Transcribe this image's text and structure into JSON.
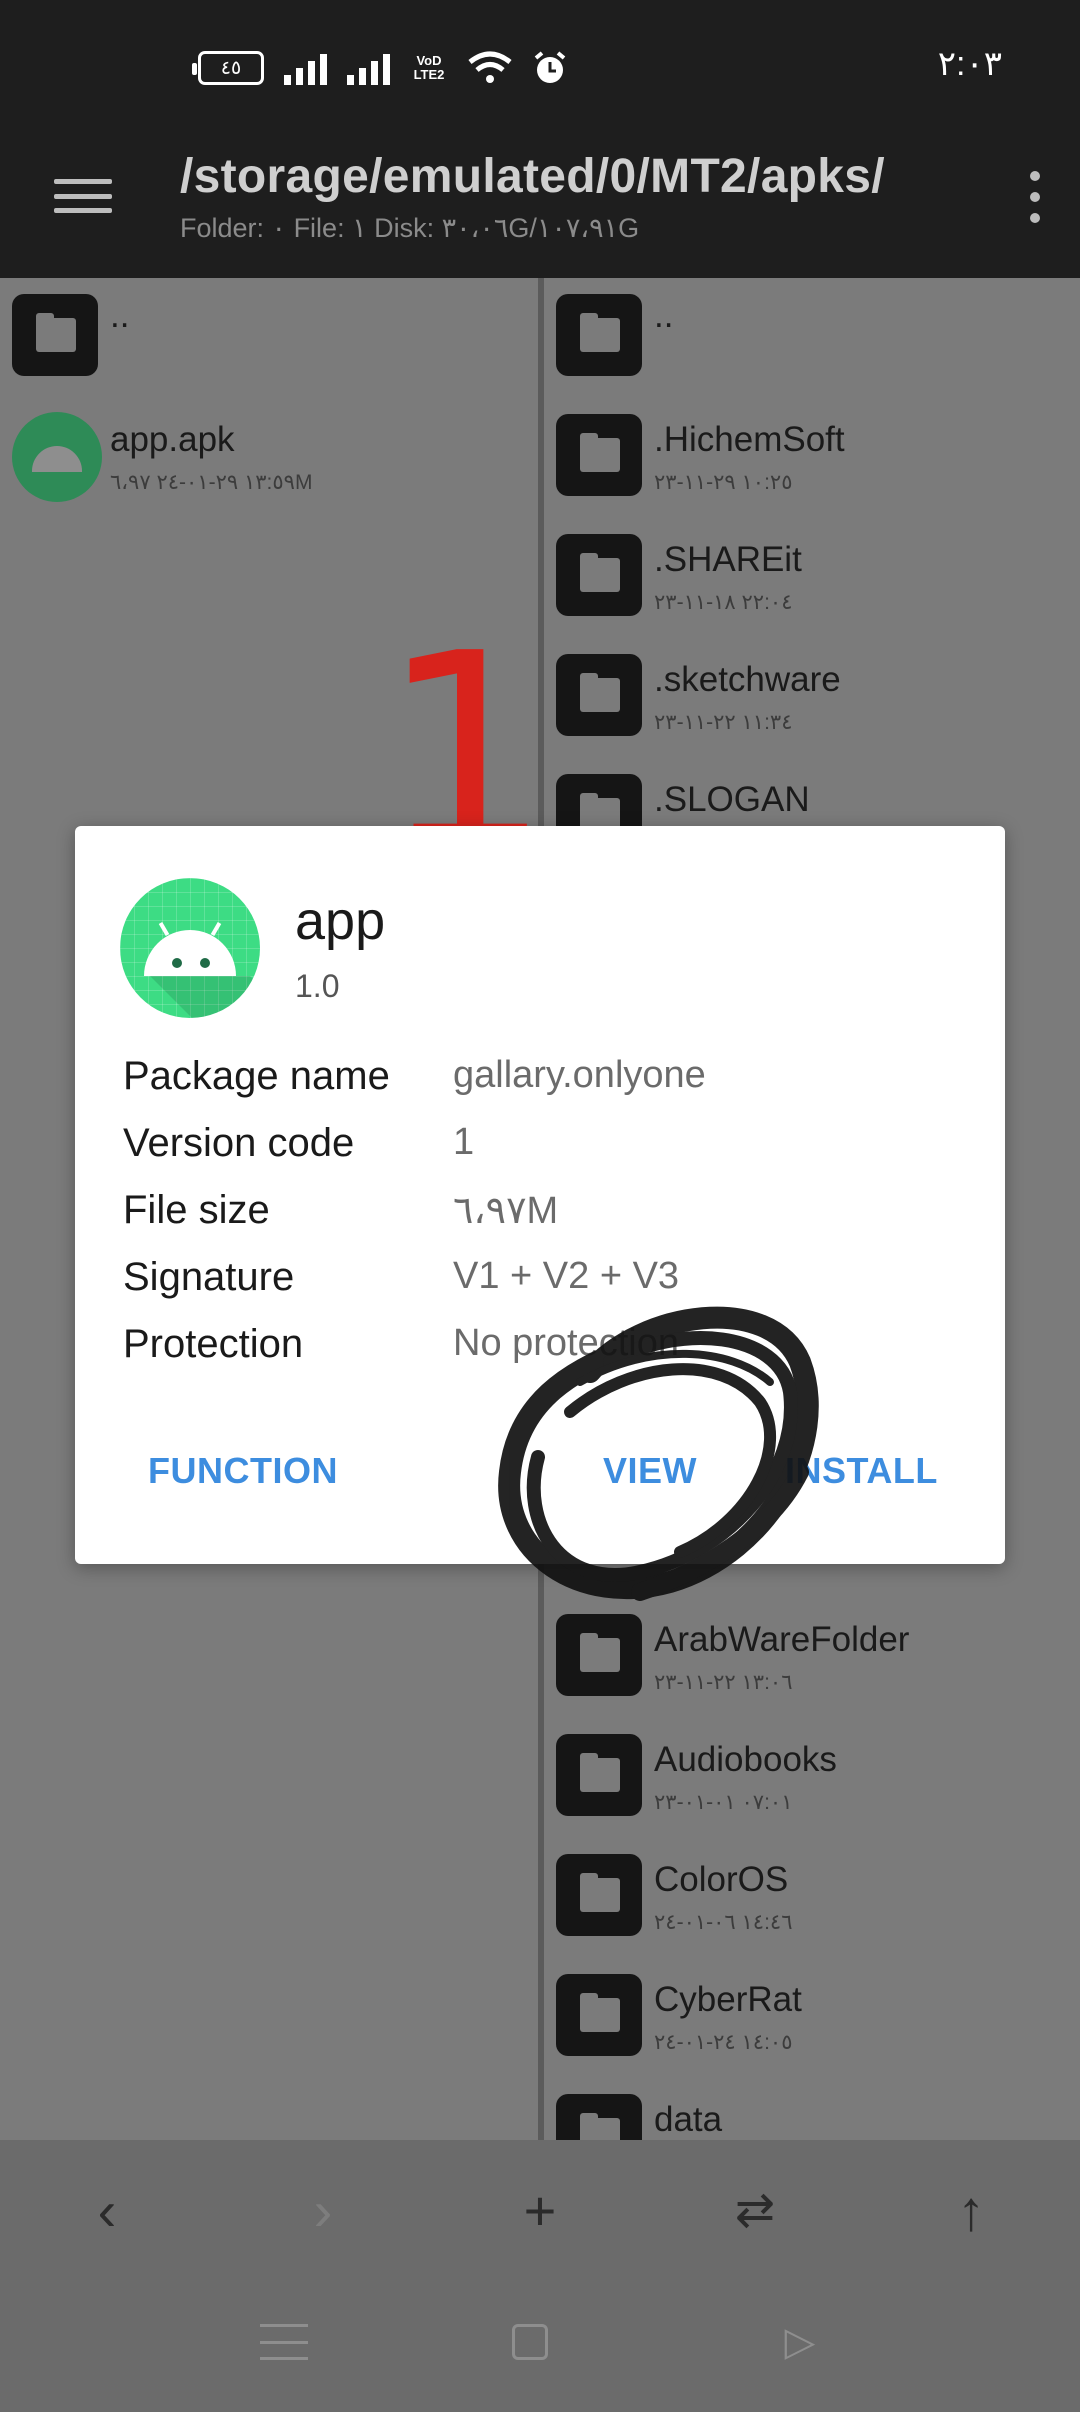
{
  "status_bar": {
    "battery": "٤٥",
    "network_label_1": "VoD",
    "network_label_2": "LTE2",
    "time": "٢:٠٣"
  },
  "toolbar": {
    "path": "/storage/emulated/0/MT2/apks/",
    "info": "Folder: ٠  File: ١  Disk: ٣٠،٠٦G/١٠٧،٩١G"
  },
  "left_pane": {
    "parent": "..",
    "files": [
      {
        "name": "app.apk",
        "meta": "١٣:٥٩ ٢٩-٠١-٢٤  ٦،٩٧M"
      }
    ]
  },
  "annotation": {
    "number": "1"
  },
  "right_pane": {
    "items": [
      {
        "name": "..",
        "meta": ""
      },
      {
        "name": ".HichemSoft",
        "meta": "١٠:٢٥ ٢٩-١١-٢٣"
      },
      {
        "name": ".SHAREit",
        "meta": "٢٢:٠٤ ١٨-١١-٢٣"
      },
      {
        "name": ".sketchware",
        "meta": "١١:٣٤ ٢٢-١١-٢٣"
      },
      {
        "name": ".SLOGAN",
        "meta": ""
      },
      {
        "name": "ArabWareFolder",
        "meta": "١٣:٠٦ ٢٢-١١-٢٣"
      },
      {
        "name": "Audiobooks",
        "meta": "٠٧:٠١ ٠١-٠١-٢٣"
      },
      {
        "name": "ColorOS",
        "meta": "١٤:٤٦ ٠٦-٠١-٢٤"
      },
      {
        "name": "CyberRat",
        "meta": "١٤:٠٥ ٢٤-٠١-٢٤"
      },
      {
        "name": "data",
        "meta": ""
      }
    ]
  },
  "dialog": {
    "app_name": "app",
    "version": "1.0",
    "rows": [
      {
        "label": "Package name",
        "value": "gallary.onlyone"
      },
      {
        "label": "Version code",
        "value": "1"
      },
      {
        "label": "File size",
        "value": "٦،٩٧M"
      },
      {
        "label": "Signature",
        "value": "V1 + V2 + V3"
      },
      {
        "label": "Protection",
        "value": "No protection"
      }
    ],
    "buttons": {
      "function": "FUNCTION",
      "view": "VIEW",
      "install": "INSTALL"
    },
    "accent_color": "#3d8ddf"
  },
  "action_bar": {
    "icons": [
      "chevron-left-icon",
      "chevron-right-icon",
      "plus-icon",
      "swap-icon",
      "arrow-up-icon"
    ]
  },
  "colors": {
    "panel_bg": "#7b7b7b",
    "toolbar_bg": "#1e1e1e",
    "annotation_red": "#d8231c"
  }
}
